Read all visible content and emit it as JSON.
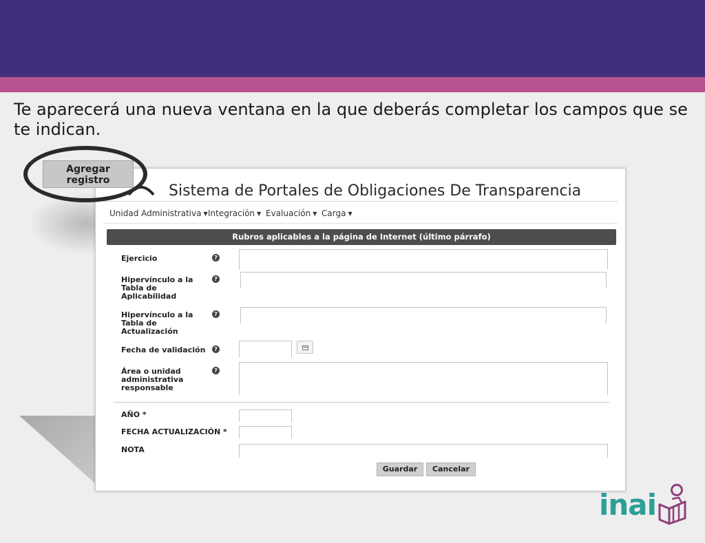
{
  "slide": {
    "intro_text": "Te aparecerá una nueva ventana en la que deberás completar los campos que se te indican.",
    "callout_button_label": "Agregar registro"
  },
  "window": {
    "title": "Sistema de Portales de Obligaciones De Transparencia",
    "menu": [
      {
        "label": "Unidad Administrativa"
      },
      {
        "label": "Integración"
      },
      {
        "label": "Evaluación"
      },
      {
        "label": "Carga"
      }
    ],
    "form_header": "Rubros aplicables a la página de Internet (último párrafo)",
    "fields": [
      {
        "label": "Ejercicio",
        "value": ""
      },
      {
        "label": "Hipervínculo a la Tabla de Aplicabilidad",
        "value": ""
      },
      {
        "label": "Hipervínculo a la Tabla de Actualización",
        "value": ""
      },
      {
        "label": "Fecha de validación",
        "value": ""
      },
      {
        "label": "Área o unidad administrativa responsable",
        "value": ""
      }
    ],
    "extra_fields": [
      {
        "label": "AÑO *",
        "value": ""
      },
      {
        "label": "FECHA ACTUALIZACIÓN *",
        "value": ""
      },
      {
        "label": "NOTA",
        "value": ""
      }
    ],
    "help_glyph": "?",
    "buttons": {
      "save": "Guardar",
      "cancel": "Cancelar"
    }
  },
  "logo": {
    "text": "inai",
    "color": "#2ba095",
    "icon_color": "#8e3f7c"
  },
  "colors": {
    "header": "#3f2f7d",
    "accent": "#b65390",
    "form_header": "#4d4d4d"
  }
}
